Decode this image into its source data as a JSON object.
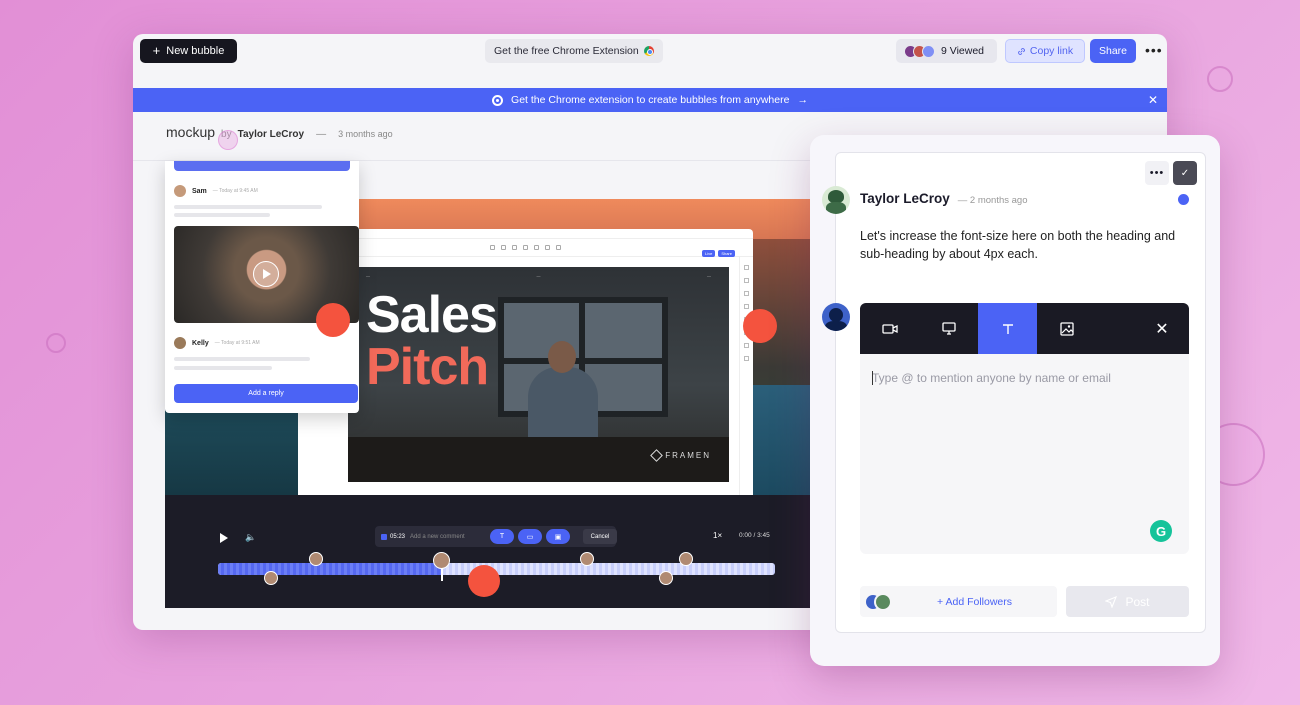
{
  "topbar": {
    "new_bubble_label": "New bubble",
    "chrome_extension_label": "Get the free Chrome Extension",
    "viewed_label": "9 Viewed",
    "copy_link_label": "Copy link",
    "share_label": "Share"
  },
  "banner": {
    "text": "Get the Chrome extension to create bubbles from anywhere",
    "arrow": "→"
  },
  "bubble": {
    "title": "mockup",
    "by": "by",
    "author": "Taylor LeCroy",
    "separator": "—",
    "ago": "3 months ago"
  },
  "thread": {
    "comments": [
      {
        "name": "Sam",
        "time": "— Today at 9:45 AM"
      },
      {
        "name": "Kelly",
        "time": "— Today at 9:51 AM"
      }
    ],
    "reply_label": "Add a reply"
  },
  "slide": {
    "headline_1": "Sales",
    "headline_2": "Pitch",
    "brand": "FRAMEN"
  },
  "player": {
    "current_time": "05:23",
    "comment_placeholder": "Add a new comment",
    "cancel_label": "Cancel",
    "speed": "1×",
    "timecode": "0:00  /  3:45",
    "progress": 0.4
  },
  "comment": {
    "author": "Taylor LeCroy",
    "ago": "— 2 months ago",
    "body": "Let's increase the font-size here on both the heading and sub-heading by about 4px each."
  },
  "composer": {
    "placeholder": "Type @ to mention anyone by name or email",
    "tools": [
      "video-icon",
      "screen-icon",
      "text-icon",
      "image-icon"
    ],
    "active_tool": "text-icon"
  },
  "footer": {
    "add_followers_label": "+ Add Followers",
    "post_label": "Post"
  },
  "colors": {
    "accent": "#4b63f5",
    "record": "#f4533e",
    "dark": "#1a1a24"
  }
}
